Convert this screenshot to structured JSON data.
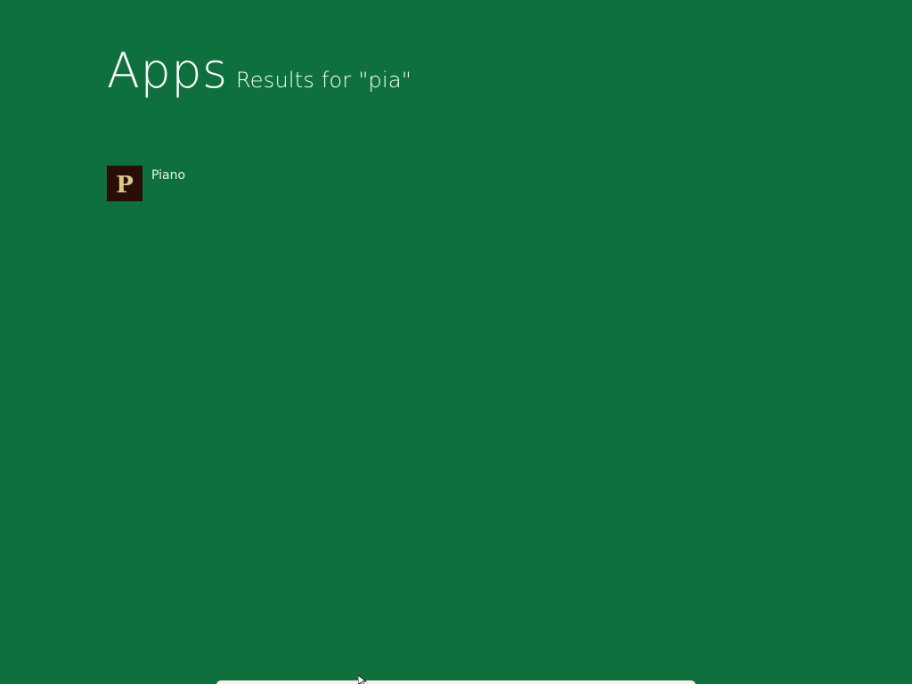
{
  "header": {
    "title": "Apps",
    "subtitle": "Results for \"pia\""
  },
  "results": [
    {
      "label": "Piano",
      "icon": "piano-app-icon",
      "icon_letter": "P"
    }
  ],
  "colors": {
    "background": "#0e703c",
    "tile_background": "#2a0d07",
    "tile_glyph": "#d9c98a"
  }
}
